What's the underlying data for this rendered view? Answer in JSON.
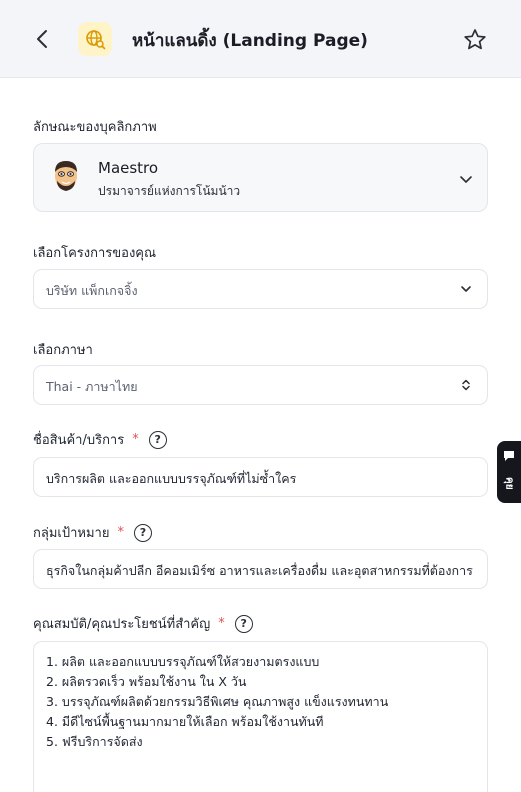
{
  "header": {
    "title": "หน้าแลนดิ้ง (Landing Page)"
  },
  "persona": {
    "label": "ลักษณะของบุคลิกภาพ",
    "name": "Maestro",
    "subtitle": "ปรมาจารย์แห่งการโน้มน้าว"
  },
  "project": {
    "label": "เลือกโครงการของคุณ",
    "value": "บริษัท แพ็กเกจจิ้ง"
  },
  "language": {
    "label": "เลือกภาษา",
    "value": "Thai - ภาษาไทย"
  },
  "product": {
    "label": "ชื่อสินค้า/บริการ",
    "required_mark": "*",
    "help": "?",
    "value": "บริการผลิต และออกแบบบรรจุภัณฑ์ที่ไม่ซ้ำใคร"
  },
  "audience": {
    "label": "กลุ่มเป้าหมาย",
    "required_mark": "*",
    "help": "?",
    "value": "ธุรกิจในกลุ่มค้าปลีก อีคอมเมิร์ซ อาหารและเครื่องดื่ม และอุตสาหกรรมที่ต้องการ"
  },
  "benefits": {
    "label": "คุณสมบัติ/คุณประโยชน์ที่สำคัญ",
    "required_mark": "*",
    "help": "?",
    "lines": [
      "1. ผลิต และออกแบบบรรจุภัณฑ์ให้สวยงามตรงแบบ",
      "2. ผลิตรวดเร็ว พร้อมใช้งาน ใน X วัน",
      "3. บรรจุภัณฑ์ผลิตด้วยกรรมวิธีพิเศษ คุณภาพสูง แข็งแรงทนทาน",
      "4. มีดีไซน์พื้นฐานมากมายให้เลือก พร้อมใช้งานทันที",
      "5. ฟรีบริการจัดส่ง"
    ]
  },
  "feedback_tab": {
    "label": "คุย"
  },
  "colors": {
    "header_bg": "#f4f5f8",
    "required": "#e05252",
    "app_icon_bg": "#fff3c8",
    "feedback_bg": "#15171c"
  }
}
